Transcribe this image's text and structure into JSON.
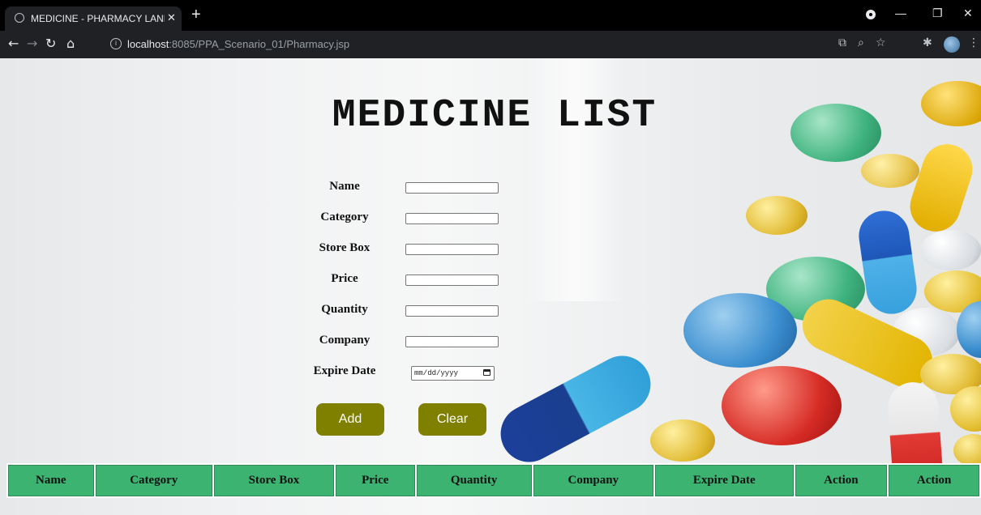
{
  "browser": {
    "tab_title": "MEDICINE - PHARMACY LANKA",
    "new_tab": "+",
    "url_host": "localhost",
    "url_rest": ":8085/PPA_Scenario_01/Pharmacy.jsp"
  },
  "page": {
    "heading": "MEDICINE LIST",
    "form": {
      "labels": [
        "Name",
        "Category",
        "Store Box",
        "Price",
        "Quantity",
        "Company",
        "Expire Date"
      ],
      "values": [
        "",
        "",
        "",
        "",
        "",
        ""
      ],
      "date_placeholder": "mm/dd/yyyy"
    },
    "buttons": {
      "add": "Add",
      "clear": "Clear"
    },
    "table": {
      "headers": [
        "Name",
        "Category",
        "Store Box",
        "Price",
        "Quantity",
        "Company",
        "Expire Date",
        "Action",
        "Action"
      ]
    }
  },
  "colors": {
    "button_bg": "#808000",
    "table_header_bg": "#3cb371"
  }
}
